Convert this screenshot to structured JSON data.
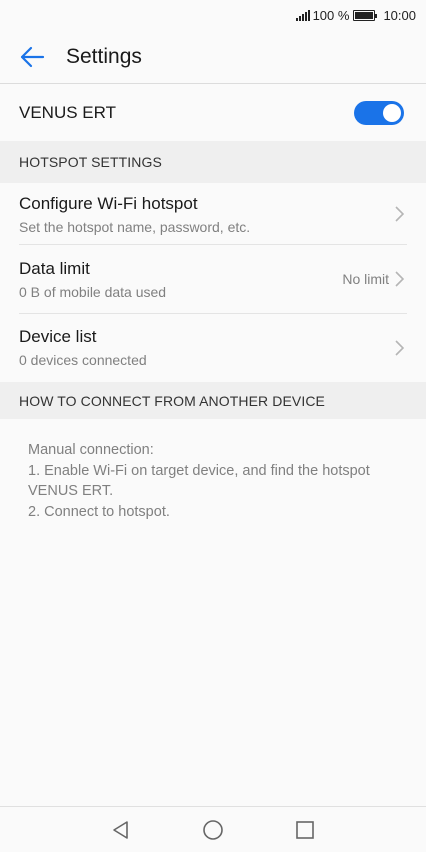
{
  "status_bar": {
    "battery_text": "100 %",
    "time": "10:00"
  },
  "app_bar": {
    "title": "Settings",
    "back_icon": "arrow-left-icon"
  },
  "hotspot": {
    "name": "VENUS ERT",
    "enabled": true,
    "accent_color": "#1a73e8"
  },
  "sections": {
    "hotspot_settings": "HOTSPOT SETTINGS",
    "how_to_connect": "HOW TO CONNECT FROM ANOTHER DEVICE"
  },
  "items": [
    {
      "title": "Configure Wi-Fi hotspot",
      "subtitle": "Set the hotspot name, password, etc.",
      "value": ""
    },
    {
      "title": "Data limit",
      "subtitle": "0 B of mobile data used",
      "value": "No limit"
    },
    {
      "title": "Device list",
      "subtitle": "0 devices connected",
      "value": ""
    }
  ],
  "instructions": {
    "line1": "Manual connection:",
    "line2": "1. Enable Wi-Fi on target device, and find the hotspot VENUS ERT.",
    "line3": "2. Connect to hotspot."
  },
  "nav": {
    "back": "triangle-back-icon",
    "home": "circle-home-icon",
    "recents": "square-recents-icon"
  }
}
